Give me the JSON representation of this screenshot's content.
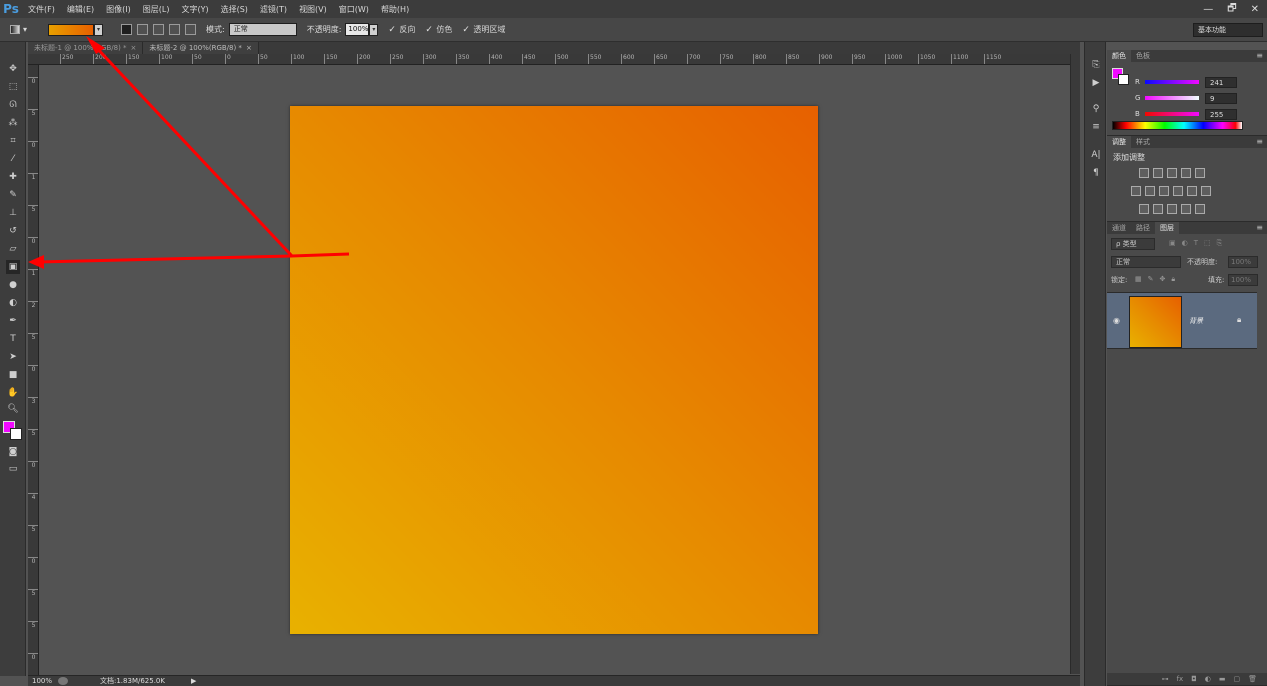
{
  "app": {
    "logo": "Ps"
  },
  "menu": [
    "文件(F)",
    "编辑(E)",
    "图像(I)",
    "图层(L)",
    "文字(Y)",
    "选择(S)",
    "滤镜(T)",
    "视图(V)",
    "窗口(W)",
    "帮助(H)"
  ],
  "window_controls": {
    "minimize": "—",
    "restore": "🗗",
    "close": "✕"
  },
  "options": {
    "mode_label": "模式:",
    "mode_value": "正常",
    "opacity_label": "不透明度:",
    "opacity_value": "100%",
    "reverse": "反向",
    "dither": "仿色",
    "transparency": "透明区域",
    "workspace": "基本功能",
    "gradient_colors": [
      "#e8a000",
      "#e86000"
    ]
  },
  "tabs": [
    {
      "label": "未标题-1 @ 100%(RGB/8) *",
      "close": "×"
    },
    {
      "label": "未标题-2 @ 100%(RGB/8) *",
      "close": "×"
    }
  ],
  "ruler_h": [
    "250",
    "200",
    "150",
    "100",
    "50",
    "0",
    "50",
    "100",
    "150",
    "200",
    "250",
    "300",
    "350",
    "400",
    "450",
    "500",
    "550",
    "600",
    "650",
    "700",
    "750",
    "800",
    "850",
    "900",
    "950",
    "1000",
    "1050",
    "1100",
    "1150"
  ],
  "ruler_v": [
    "0",
    "5",
    "0",
    "1",
    "5",
    "0",
    "1",
    "2",
    "5",
    "0",
    "3",
    "5",
    "0",
    "4",
    "5",
    "0",
    "5",
    "5",
    "0"
  ],
  "status": {
    "zoom": "100%",
    "doc_info": "文档:1.83M/625.0K",
    "arrow": "▶"
  },
  "color_panel": {
    "tabs": [
      "颜色",
      "色板"
    ],
    "fg": "#f109ff",
    "bg": "#ffffff",
    "channels": [
      {
        "label": "R",
        "value": "241"
      },
      {
        "label": "G",
        "value": "9"
      },
      {
        "label": "B",
        "value": "255"
      }
    ]
  },
  "adjust_panel": {
    "tabs": [
      "调整",
      "样式"
    ],
    "title": "添加调整"
  },
  "layers_panel": {
    "tabs": [
      "通道",
      "路径",
      "图层"
    ],
    "filter": "ρ 类型",
    "blend": "正常",
    "opacity_label": "不透明度:",
    "opacity_value": "100%",
    "lock_label": "锁定:",
    "fill_label": "填充:",
    "fill_value": "100%",
    "layer": {
      "name": "背景"
    }
  },
  "document": {
    "gradient_colors": [
      "#e76000",
      "#e78a00",
      "#e8b100"
    ]
  },
  "foreground_color": "#f109ff",
  "background_color": "#ffffff",
  "annotation_color": "#ff0000"
}
